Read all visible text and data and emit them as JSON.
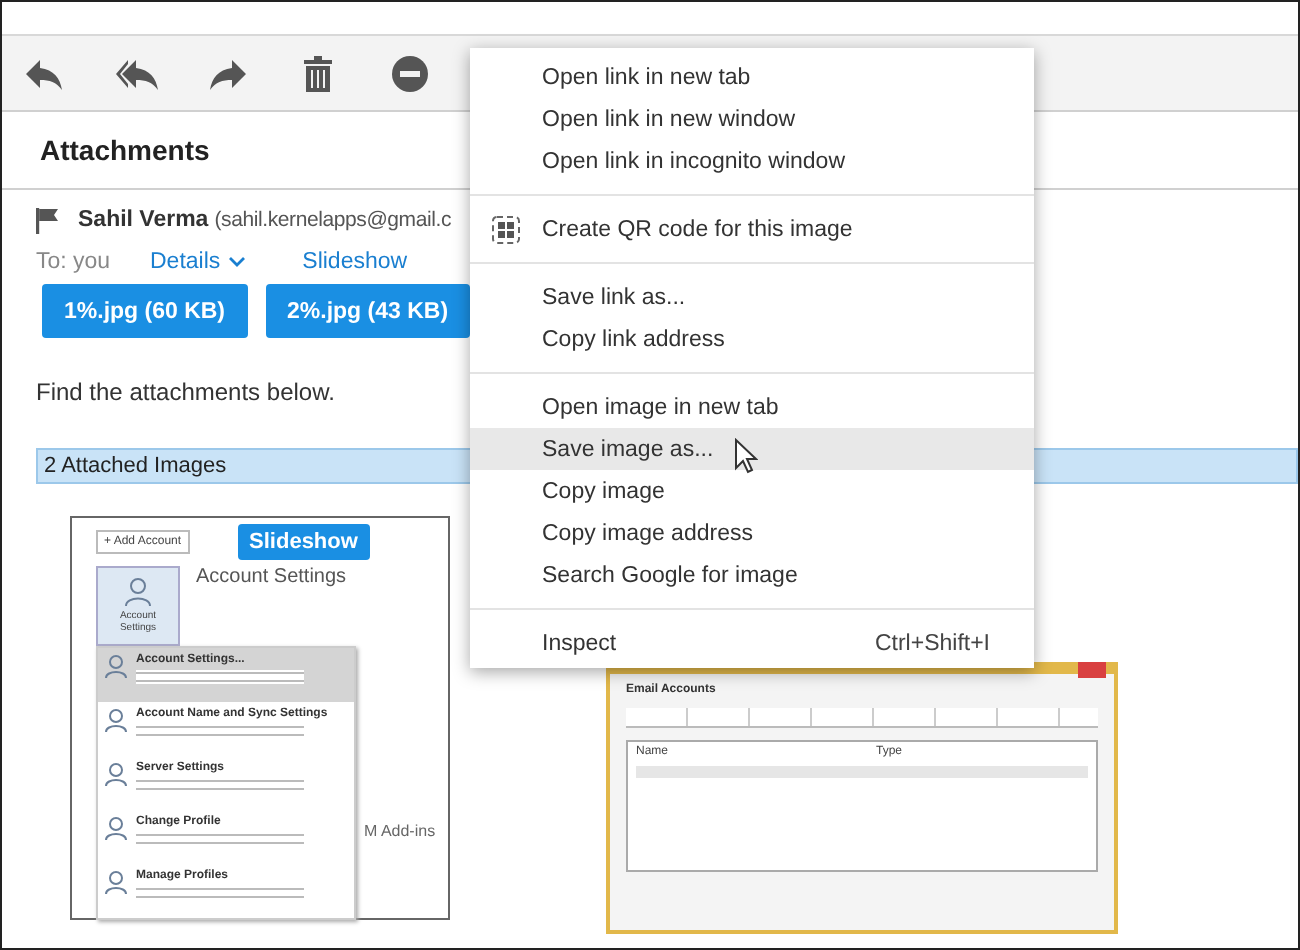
{
  "toolbar": [
    {
      "kind": "reply"
    },
    {
      "kind": "reply-all"
    },
    {
      "kind": "forward"
    },
    {
      "kind": "delete"
    },
    {
      "kind": "block"
    }
  ],
  "message": {
    "subject": "Attachments",
    "sender_name": "Sahil Verma",
    "sender_email": "(sahil.kernelapps@gmail.c",
    "to": "To: you",
    "links": [
      {
        "label": "Details",
        "caret": true
      },
      {
        "label": "Slideshow",
        "caret": false
      }
    ],
    "attachments": [
      "1%.jpg (60 KB)",
      "2%.jpg (43 KB)"
    ],
    "body": "Find the attachments below.",
    "section": "2 Attached Images",
    "images": [
      {
        "kind": "account-settings",
        "badge": "Slideshow",
        "add_button": "+ Add Account",
        "heading": "Account Settings",
        "tile": "Account Settings",
        "menu": [
          "Account Settings...",
          "Account Name and Sync Settings",
          "Server Settings",
          "Change Profile",
          "Manage Profiles"
        ],
        "side_heading": "M Add-ins"
      },
      {
        "kind": "email-accounts",
        "title": "Email Accounts",
        "columns": [
          "Name",
          "Type"
        ]
      }
    ]
  },
  "context_menu": {
    "groups": [
      [
        {
          "label": "Open link in new tab",
          "selected": false
        },
        {
          "label": "Open link in new window",
          "selected": false
        },
        {
          "label": "Open link in incognito window",
          "selected": false
        }
      ],
      [
        {
          "label": "Create QR code for this image",
          "kind": "with-icon",
          "selected": false
        }
      ],
      [
        {
          "label": "Save link as...",
          "selected": false
        },
        {
          "label": "Copy link address",
          "selected": false
        }
      ],
      [
        {
          "label": "Open image in new tab",
          "selected": false
        },
        {
          "label": "Save image as...",
          "selected": true
        },
        {
          "label": "Copy image",
          "selected": false
        },
        {
          "label": "Copy image address",
          "selected": false
        },
        {
          "label": "Search Google for image",
          "selected": false
        }
      ],
      [
        {
          "label": "Inspect",
          "shortcut": "Ctrl+Shift+I",
          "selected": false
        }
      ]
    ]
  }
}
